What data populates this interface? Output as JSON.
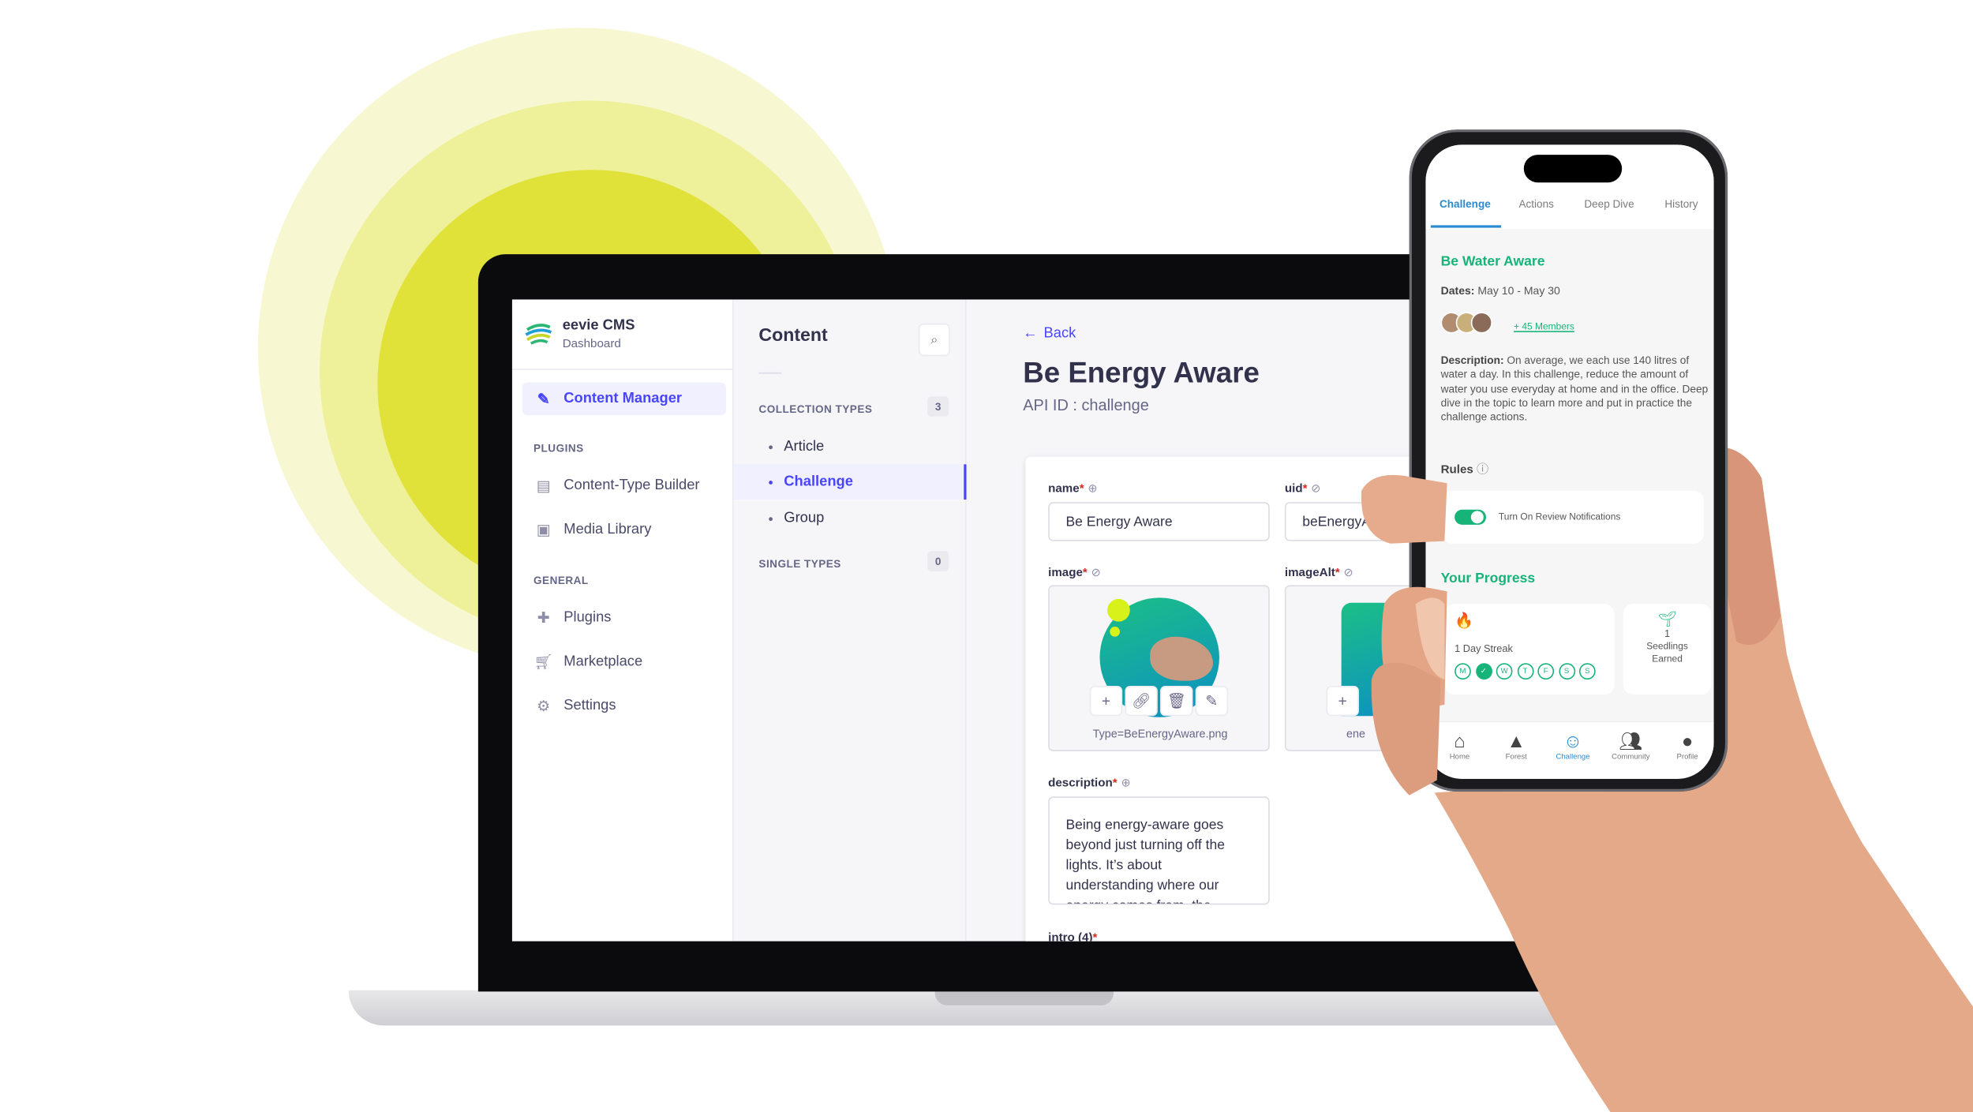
{
  "colors": {
    "accent": "#4945ff",
    "app_green": "#17b47a",
    "app_blue": "#2a8bd0",
    "sun": "#e0e23a"
  },
  "cms": {
    "brand": {
      "name": "eevie CMS",
      "subtitle": "Dashboard"
    },
    "sidebar": {
      "active_item": {
        "label": "Content Manager",
        "icon": "edit-icon"
      },
      "sections": [
        {
          "label": "PLUGINS",
          "items": [
            {
              "label": "Content-Type Builder",
              "icon": "layout-icon"
            },
            {
              "label": "Media Library",
              "icon": "image-icon"
            }
          ]
        },
        {
          "label": "GENERAL",
          "items": [
            {
              "label": "Plugins",
              "icon": "puzzle-icon"
            },
            {
              "label": "Marketplace",
              "icon": "cart-icon"
            },
            {
              "label": "Settings",
              "icon": "gear-icon"
            }
          ]
        }
      ]
    },
    "content_panel": {
      "title": "Content",
      "collection_label": "COLLECTION TYPES",
      "collection_count": "3",
      "collection_items": [
        "Article",
        "Challenge",
        "Group"
      ],
      "selected": "Challenge",
      "single_label": "SINGLE TYPES",
      "single_count": "0"
    },
    "main": {
      "back": "Back",
      "title": "Be Energy Aware",
      "api_id": "API ID : challenge",
      "fields": {
        "name": {
          "label": "name",
          "value": "Be Energy Aware"
        },
        "uid": {
          "label": "uid",
          "value": "beEnergyAware"
        },
        "image": {
          "label": "image",
          "filename": "Type=BeEnergyAware.png"
        },
        "imageAlt": {
          "label": "imageAlt",
          "filename": "ene"
        },
        "description": {
          "label": "description",
          "value": "Being energy-aware goes beyond just turning off the lights. It’s about understanding where our energy comes from, the"
        },
        "intro": {
          "label": "intro (4)"
        }
      }
    }
  },
  "app": {
    "tabs": [
      "Challenge",
      "Actions",
      "Deep Dive",
      "History"
    ],
    "active_tab": "Challenge",
    "challenge_title": "Be Water Aware",
    "dates_label": "Dates:",
    "dates_value": "May 10 - May 30",
    "members": "+ 45 Members",
    "description_label": "Description:",
    "description": "On average, we each use 140 litres of water a day. In this challenge, reduce the amount of water you use everyday at home and in the office. Deep dive in the topic to learn more and put in practice the challenge actions.",
    "rules_label": "Rules",
    "notification_toggle": {
      "label": "Turn On Review Notifications",
      "on": true
    },
    "progress_title": "Your Progress",
    "streak": {
      "text": "1  Day Streak",
      "days": [
        "M",
        "✓",
        "W",
        "T",
        "F",
        "S",
        "S"
      ],
      "completed": [
        1
      ]
    },
    "seedlings": {
      "count": "1",
      "label": "Seedlings Earned"
    },
    "nav": [
      {
        "label": "Home",
        "icon": "home-icon"
      },
      {
        "label": "Forest",
        "icon": "tree-icon"
      },
      {
        "label": "Challenge",
        "icon": "smile-icon"
      },
      {
        "label": "Community",
        "icon": "people-icon"
      },
      {
        "label": "Profile",
        "icon": "profile-icon"
      }
    ]
  }
}
